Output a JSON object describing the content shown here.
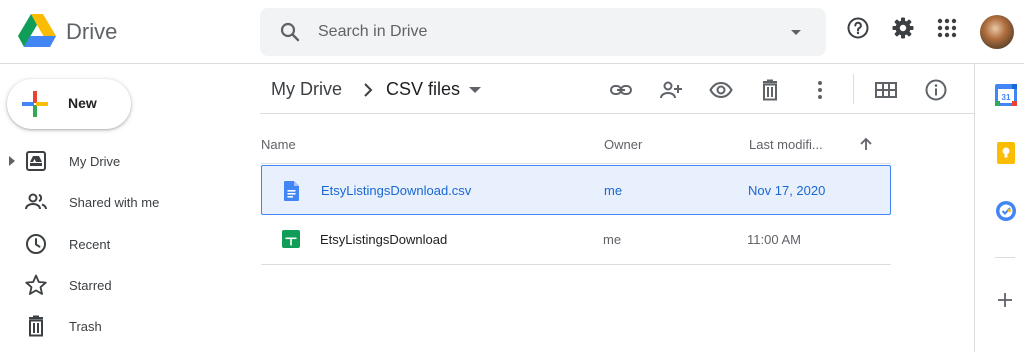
{
  "app": {
    "name": "Drive"
  },
  "search": {
    "placeholder": "Search in Drive",
    "value": ""
  },
  "header": {
    "icons": [
      "help-icon",
      "settings-icon",
      "apps-grid-icon"
    ],
    "avatar": "account-avatar"
  },
  "sidebar": {
    "new_label": "New",
    "items": [
      {
        "label": "My Drive",
        "icon": "my-drive-icon"
      },
      {
        "label": "Shared with me",
        "icon": "shared-icon"
      },
      {
        "label": "Recent",
        "icon": "clock-icon"
      },
      {
        "label": "Starred",
        "icon": "star-icon"
      },
      {
        "label": "Trash",
        "icon": "trash-icon"
      }
    ]
  },
  "breadcrumb": {
    "root": "My Drive",
    "current": "CSV files"
  },
  "toolbar": {
    "icons": [
      "get-link-icon",
      "share-icon",
      "preview-icon",
      "delete-icon",
      "more-actions-icon",
      "grid-view-icon",
      "info-icon"
    ]
  },
  "list": {
    "columns": {
      "name": "Name",
      "owner": "Owner",
      "modified": "Last modifi..."
    },
    "sort": "ascending",
    "rows": [
      {
        "name": "EtsyListingsDownload.csv",
        "owner": "me",
        "modified": "Nov 17, 2020",
        "type": "csv-doc-icon",
        "selected": true
      },
      {
        "name": "EtsyListingsDownload",
        "owner": "me",
        "modified": "11:00 AM",
        "type": "sheets-icon",
        "selected": false
      }
    ]
  },
  "side_panel": {
    "apps": [
      "calendar-icon",
      "keep-icon",
      "tasks-icon"
    ],
    "calendar_day": "31"
  },
  "colors": {
    "accent": "#1a73e8",
    "selected_bg": "#e8f0fe",
    "selected_border": "#4285f4",
    "sheets_green": "#0f9d58",
    "keep_yellow": "#fbbc04"
  }
}
